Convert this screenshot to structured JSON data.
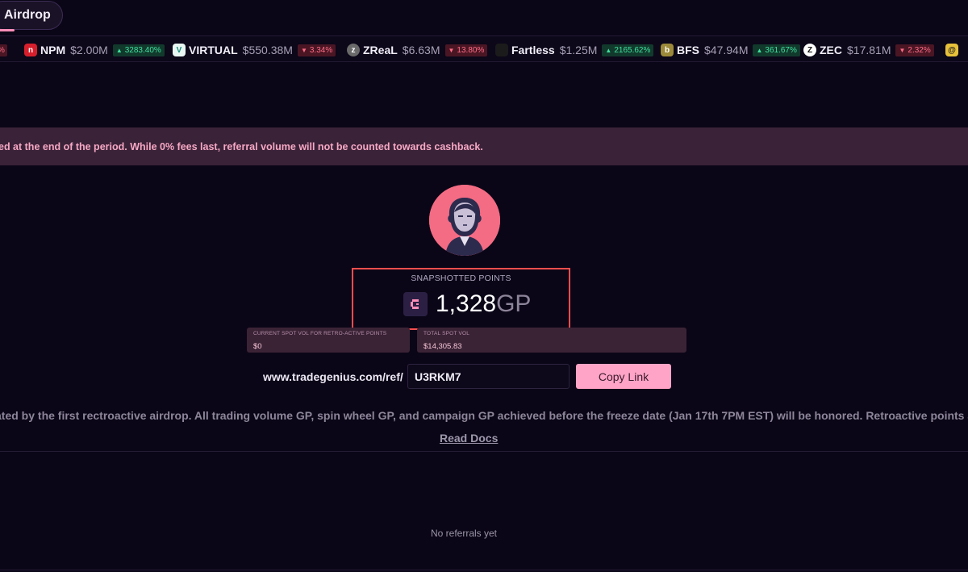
{
  "nav": {
    "airdrop_tab": "Airdrop"
  },
  "ticker": [
    {
      "symbol": "",
      "mcap": "",
      "change": "%",
      "dir": "down",
      "logo_color": "#c0243a"
    },
    {
      "symbol": "NPM",
      "mcap": "$2.00M",
      "change": "3283.40%",
      "dir": "up",
      "logo_color": "#d61f2c",
      "logo_char": "n"
    },
    {
      "symbol": "VIRTUAL",
      "mcap": "$550.38M",
      "change": "3.34%",
      "dir": "down",
      "logo_color": "#2bb7a5",
      "logo_char": "V"
    },
    {
      "symbol": "ZReaL",
      "mcap": "$6.63M",
      "change": "13.80%",
      "dir": "down",
      "logo_color": "#555",
      "logo_char": "Z"
    },
    {
      "symbol": "Fartless",
      "mcap": "$1.25M",
      "change": "2165.62%",
      "dir": "up",
      "logo_color": "#222",
      "logo_char": "F"
    },
    {
      "symbol": "BFS",
      "mcap": "$47.94M",
      "change": "361.67%",
      "dir": "up",
      "logo_color": "#9c8a3a",
      "logo_char": "B"
    },
    {
      "symbol": "ZEC",
      "mcap": "$17.81M",
      "change": "2.32%",
      "dir": "down",
      "logo_color": "#ffffff",
      "logo_char": "Z"
    },
    {
      "symbol": "",
      "mcap": "",
      "change": "",
      "dir": "up",
      "logo_color": "#e8c13a",
      "logo_char": ""
    }
  ],
  "banner": {
    "text": "ed at the end of the period. While 0% fees last, referral volume will not be counted towards cashback."
  },
  "points": {
    "label": "SNAPSHOTTED POINTS",
    "value": "1,328",
    "unit": "GP"
  },
  "stats": {
    "spot_vol_label": "CURRENT SPOT VOL FOR RETRO-ACTIVE POINTS",
    "spot_vol_value": "$0",
    "total_label": "TOTAL SPOT VOL",
    "total_value": "$14,305.83"
  },
  "referral": {
    "prefix": "www.tradegenius.com/ref/",
    "code": "U3RKM7",
    "copy_label": "Copy Link"
  },
  "info": {
    "text": "ated by the first rectroactive airdrop. All trading volume GP, spin wheel GP, and campaign GP achieved before the freeze date (Jan 17th 7PM EST) will be honored. Retroactive points are fully",
    "read_docs": "Read Docs"
  },
  "referrals_empty": "No referrals yet",
  "colors": {
    "background": "#0b0617",
    "banner": "#3a2238",
    "accent_pink": "#ffa4c6",
    "highlight_border": "#ff4e4e",
    "up": "#3fe0a0",
    "down": "#ff6b86"
  }
}
